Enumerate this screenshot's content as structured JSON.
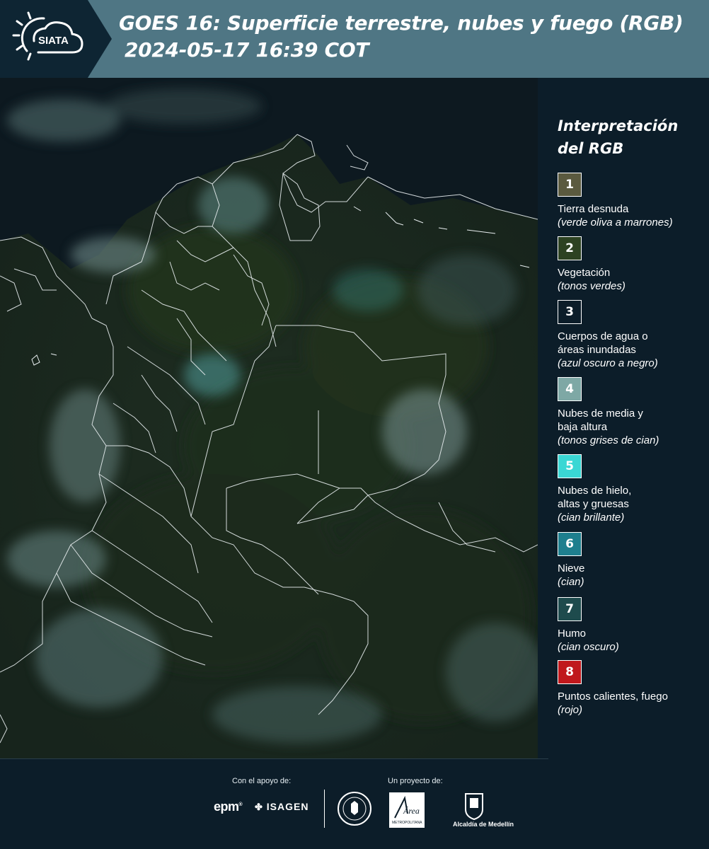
{
  "header": {
    "logo_text": "SIATA",
    "title_line1": "GOES 16: Superficie terrestre, nubes y fuego (RGB)",
    "title_line2": "2024-05-17 16:39 COT"
  },
  "legend": {
    "title_line1": "Interpretación",
    "title_line2": "del RGB",
    "items": [
      {
        "num": "1",
        "color": "#5b5a3f",
        "label": "Tierra desnuda",
        "sub": "(verde oliva a marrones)"
      },
      {
        "num": "2",
        "color": "#2d4222",
        "label": "Vegetación",
        "sub": "(tonos verdes)"
      },
      {
        "num": "3",
        "color": "#0c1d29",
        "label": "Cuerpos de agua o\náreas inundadas",
        "sub": "(azul oscuro a negro)"
      },
      {
        "num": "4",
        "color": "#7ea8a5",
        "label": "Nubes de media y\nbaja altura",
        "sub": "(tonos grises de cian)"
      },
      {
        "num": "5",
        "color": "#3ad7d4",
        "label": "Nubes de hielo,\naltas y gruesas",
        "sub": "(cian brillante)"
      },
      {
        "num": "6",
        "color": "#1e7f8e",
        "label": "Nieve",
        "sub": "(cian)"
      },
      {
        "num": "7",
        "color": "#1e4b4d",
        "label": "Humo",
        "sub": "(cian oscuro)"
      },
      {
        "num": "8",
        "color": "#c0181c",
        "label": "Puntos calientes, fuego",
        "sub": "(rojo)"
      }
    ]
  },
  "footer": {
    "support_label": "Con el apoyo de:",
    "project_label": "Un proyecto de:",
    "epm": "epm",
    "isagen": "ISAGEN",
    "area_text": "Área",
    "area_sub": "METROPOLITANA",
    "alcaldia": "Alcaldía de Medellín"
  }
}
